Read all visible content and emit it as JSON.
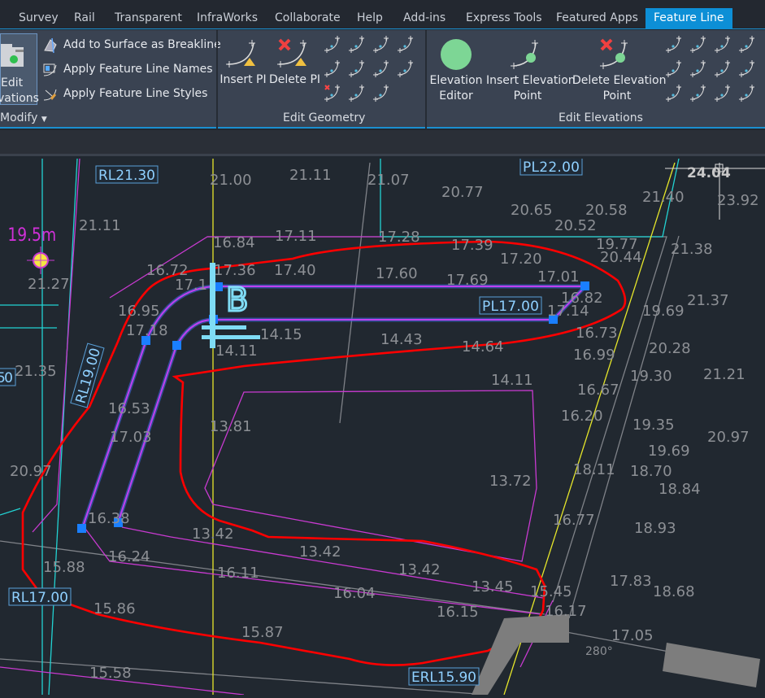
{
  "tabs": [
    "Survey",
    "Rail",
    "Transparent",
    "InfraWorks",
    "Collaborate",
    "Help",
    "Add-ins",
    "Express Tools",
    "Featured Apps",
    "Feature Line"
  ],
  "active_tab": "Feature Line",
  "modify": {
    "edit_line1": "Edit",
    "edit_line2": "vations",
    "add_breakline": "Add to Surface as Breakline",
    "apply_names": "Apply Feature Line Names",
    "apply_styles": "Apply Feature Line Styles",
    "title": "Modify"
  },
  "edit_geometry": {
    "insert_pi": "Insert PI",
    "delete_pi": "Delete PI",
    "title": "Edit Geometry"
  },
  "edit_elevations": {
    "elevation_editor_1": "Elevation",
    "elevation_editor_2": "Editor",
    "insert_elev_1": "Insert Elevation",
    "insert_elev_2": "Point",
    "delete_elev_1": "Delete Elevation",
    "delete_elev_2": "Point",
    "title": "Edit Elevations"
  },
  "drawing": {
    "spot_levels": [
      "21.00",
      "21.11",
      "21.07",
      "20.77",
      "20.65",
      "20.58",
      "20.52",
      "21.40",
      "23.92",
      "21.11",
      "21.27",
      "16.84",
      "17.11",
      "17.28",
      "17.39",
      "17.20",
      "19.77",
      "21.38",
      "20.44",
      "16.72",
      "17.36",
      "17.40",
      "17.60",
      "17.69",
      "17.01",
      "16.82",
      "17.14",
      "19.69",
      "21.37",
      "17.1",
      "16.95",
      "17.18",
      "14.15",
      "14.11",
      "14.43",
      "14.64",
      "16.73",
      "20.28",
      "16.99",
      "19.30",
      "21.21",
      "14.11",
      "16.67",
      "21.35",
      "16.53",
      "16.20",
      "19.35",
      "17.03",
      "13.81",
      "20.97",
      "19.69",
      "18.70",
      "18.11",
      "18.84",
      "20.97",
      "13.72",
      "16.77",
      "18.93",
      "16.38",
      "13.42",
      "16.24",
      "13.42",
      "15.88",
      "16.11",
      "13.42",
      "17.83",
      "16.04",
      "13.45",
      "15.45",
      "18.68",
      "15.86",
      "16.15",
      "16.17",
      "15.87",
      "17.05",
      "15.58",
      "280°"
    ],
    "cursor_value": "24.04",
    "tags": [
      "RL21.30",
      "PL22.00",
      "PL17.00",
      "RL19.00",
      "RL17.00",
      "ERL15.90",
      "50"
    ],
    "dimension": "19.5m",
    "text_B": "B"
  },
  "colors": {
    "accent": "#0d8fd6",
    "feature_line": "#c03ff0",
    "selection": "#ff0000",
    "grip": "#1a7fff",
    "cyan": "#22d3d3",
    "yellow": "#e6e62a"
  }
}
